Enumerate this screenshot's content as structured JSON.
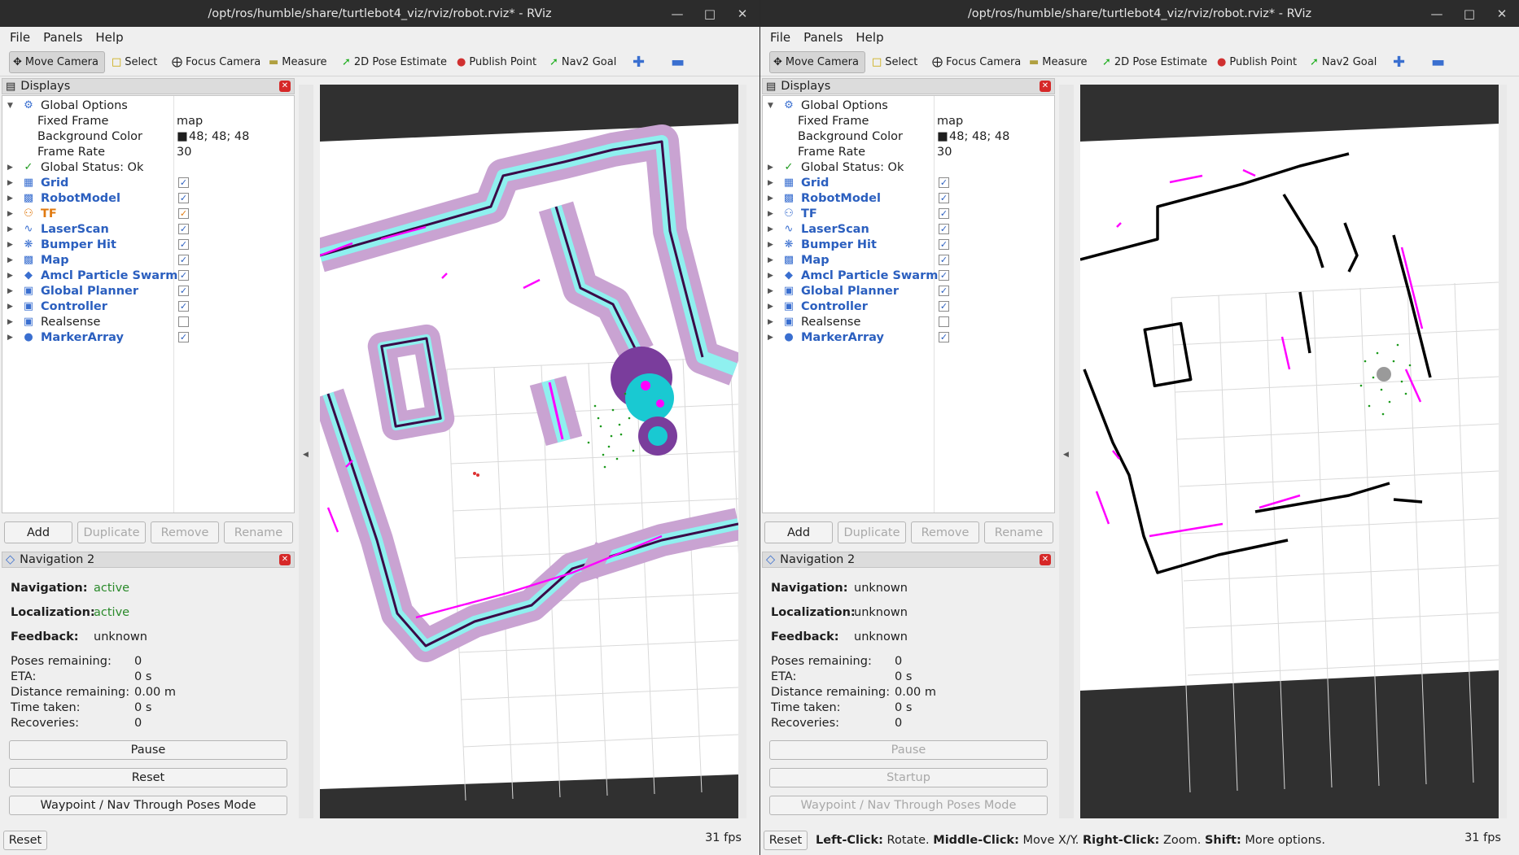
{
  "windows": [
    {
      "title": "/opt/ros/humble/share/turtlebot4_viz/rviz/robot.rviz* - RViz",
      "menu": [
        "File",
        "Panels",
        "Help"
      ],
      "toolbar": [
        "Move Camera",
        "Select",
        "Focus Camera",
        "Measure",
        "2D Pose Estimate",
        "Publish Point",
        "Nav2 Goal"
      ],
      "displays_title": "Displays",
      "global_options": "Global Options",
      "props": [
        {
          "name": "Fixed Frame",
          "value": "map"
        },
        {
          "name": "Background Color",
          "value": "48; 48; 48"
        },
        {
          "name": "Frame Rate",
          "value": "30"
        }
      ],
      "global_status": "Global Status: Ok",
      "displays": [
        {
          "name": "Grid",
          "checked": true,
          "style": "blue"
        },
        {
          "name": "RobotModel",
          "checked": true,
          "style": "blue"
        },
        {
          "name": "TF",
          "checked": true,
          "style": "orange"
        },
        {
          "name": "LaserScan",
          "checked": true,
          "style": "blue"
        },
        {
          "name": "Bumper Hit",
          "checked": true,
          "style": "blue"
        },
        {
          "name": "Map",
          "checked": true,
          "style": "blue"
        },
        {
          "name": "Amcl Particle Swarm",
          "checked": true,
          "style": "blue"
        },
        {
          "name": "Global Planner",
          "checked": true,
          "style": "blue"
        },
        {
          "name": "Controller",
          "checked": true,
          "style": "blue"
        },
        {
          "name": "Realsense",
          "checked": false,
          "style": "plain"
        },
        {
          "name": "MarkerArray",
          "checked": true,
          "style": "blue"
        }
      ],
      "buttons": [
        "Add",
        "Duplicate",
        "Remove",
        "Rename"
      ],
      "nav_title": "Navigation 2",
      "nav_status": [
        {
          "label": "Navigation:",
          "value": "active"
        },
        {
          "label": "Localization:",
          "value": "active"
        },
        {
          "label": "Feedback:",
          "value": "unknown"
        }
      ],
      "nav_metrics": [
        {
          "label": "Poses remaining:",
          "value": "0"
        },
        {
          "label": "ETA:",
          "value": "0 s"
        },
        {
          "label": "Distance remaining:",
          "value": "0.00 m"
        },
        {
          "label": "Time taken:",
          "value": "0 s"
        },
        {
          "label": "Recoveries:",
          "value": "0"
        }
      ],
      "nav_buttons": [
        "Pause",
        "Reset",
        "Waypoint / Nav Through Poses Mode"
      ],
      "nav_buttons_disabled": false,
      "reset": "Reset",
      "hint": "",
      "fps": "31 fps"
    },
    {
      "title": "/opt/ros/humble/share/turtlebot4_viz/rviz/robot.rviz* - RViz",
      "menu": [
        "File",
        "Panels",
        "Help"
      ],
      "toolbar": [
        "Move Camera",
        "Select",
        "Focus Camera",
        "Measure",
        "2D Pose Estimate",
        "Publish Point",
        "Nav2 Goal"
      ],
      "displays_title": "Displays",
      "global_options": "Global Options",
      "props": [
        {
          "name": "Fixed Frame",
          "value": "map"
        },
        {
          "name": "Background Color",
          "value": "48; 48; 48"
        },
        {
          "name": "Frame Rate",
          "value": "30"
        }
      ],
      "global_status": "Global Status: Ok",
      "displays": [
        {
          "name": "Grid",
          "checked": true,
          "style": "blue"
        },
        {
          "name": "RobotModel",
          "checked": true,
          "style": "blue"
        },
        {
          "name": "TF",
          "checked": true,
          "style": "blue"
        },
        {
          "name": "LaserScan",
          "checked": true,
          "style": "blue"
        },
        {
          "name": "Bumper Hit",
          "checked": true,
          "style": "blue"
        },
        {
          "name": "Map",
          "checked": true,
          "style": "blue"
        },
        {
          "name": "Amcl Particle Swarm",
          "checked": true,
          "style": "blue"
        },
        {
          "name": "Global Planner",
          "checked": true,
          "style": "blue"
        },
        {
          "name": "Controller",
          "checked": true,
          "style": "blue"
        },
        {
          "name": "Realsense",
          "checked": false,
          "style": "plain"
        },
        {
          "name": "MarkerArray",
          "checked": true,
          "style": "blue"
        }
      ],
      "buttons": [
        "Add",
        "Duplicate",
        "Remove",
        "Rename"
      ],
      "nav_title": "Navigation 2",
      "nav_status": [
        {
          "label": "Navigation:",
          "value": "unknown"
        },
        {
          "label": "Localization:",
          "value": "unknown"
        },
        {
          "label": "Feedback:",
          "value": "unknown"
        }
      ],
      "nav_metrics": [
        {
          "label": "Poses remaining:",
          "value": "0"
        },
        {
          "label": "ETA:",
          "value": "0 s"
        },
        {
          "label": "Distance remaining:",
          "value": "0.00 m"
        },
        {
          "label": "Time taken:",
          "value": "0 s"
        },
        {
          "label": "Recoveries:",
          "value": "0"
        }
      ],
      "nav_buttons": [
        "Pause",
        "Startup",
        "Waypoint / Nav Through Poses Mode"
      ],
      "nav_buttons_disabled": true,
      "reset": "Reset",
      "hint": {
        "a": "Left-Click:",
        "b": " Rotate. ",
        "c": "Middle-Click:",
        "d": " Move X/Y. ",
        "e": "Right-Click:",
        "f": " Zoom. ",
        "g": "Shift:",
        "h": " More options."
      },
      "fps": "31 fps"
    }
  ],
  "colors": {
    "background": "#303030",
    "accent": "#2b5fbf",
    "active": "#2a8a2a",
    "warn": "#e07a10",
    "path": "#ff00ff"
  }
}
